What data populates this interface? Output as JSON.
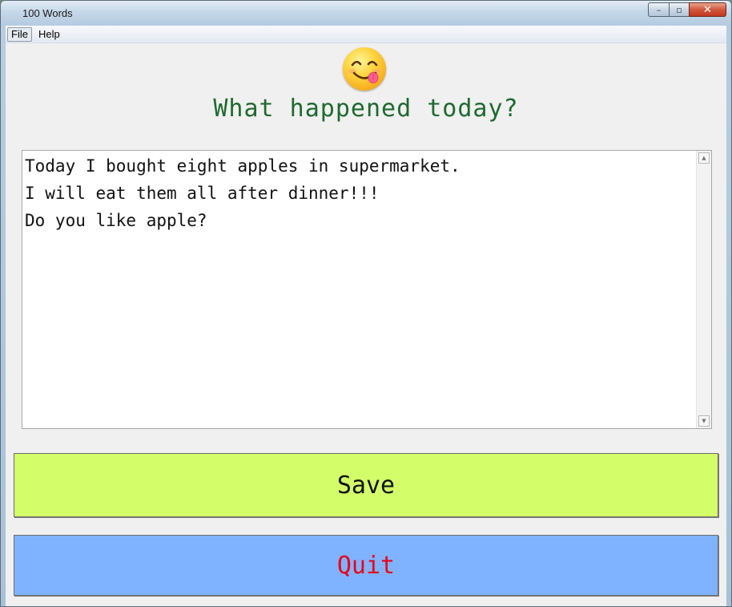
{
  "window": {
    "title": "100 Words",
    "minimize_label": "–",
    "maximize_label": "▫",
    "close_label": "✕"
  },
  "menu": {
    "items": [
      {
        "label": "File"
      },
      {
        "label": "Help"
      }
    ]
  },
  "header": {
    "emoji_icon": "smiling-face-tongue-icon",
    "title": "What happened today?"
  },
  "editor": {
    "text": "Today I bought eight apples in supermarket.\nI will eat them all after dinner!!!\nDo you like apple?",
    "scroll_up": "▲",
    "scroll_down": "▼"
  },
  "buttons": {
    "save_label": "Save",
    "quit_label": "Quit"
  },
  "colors": {
    "heading": "#1f6a2f",
    "save_bg": "#d3fe6a",
    "quit_bg": "#80b3ff",
    "quit_text": "#e8001c"
  }
}
